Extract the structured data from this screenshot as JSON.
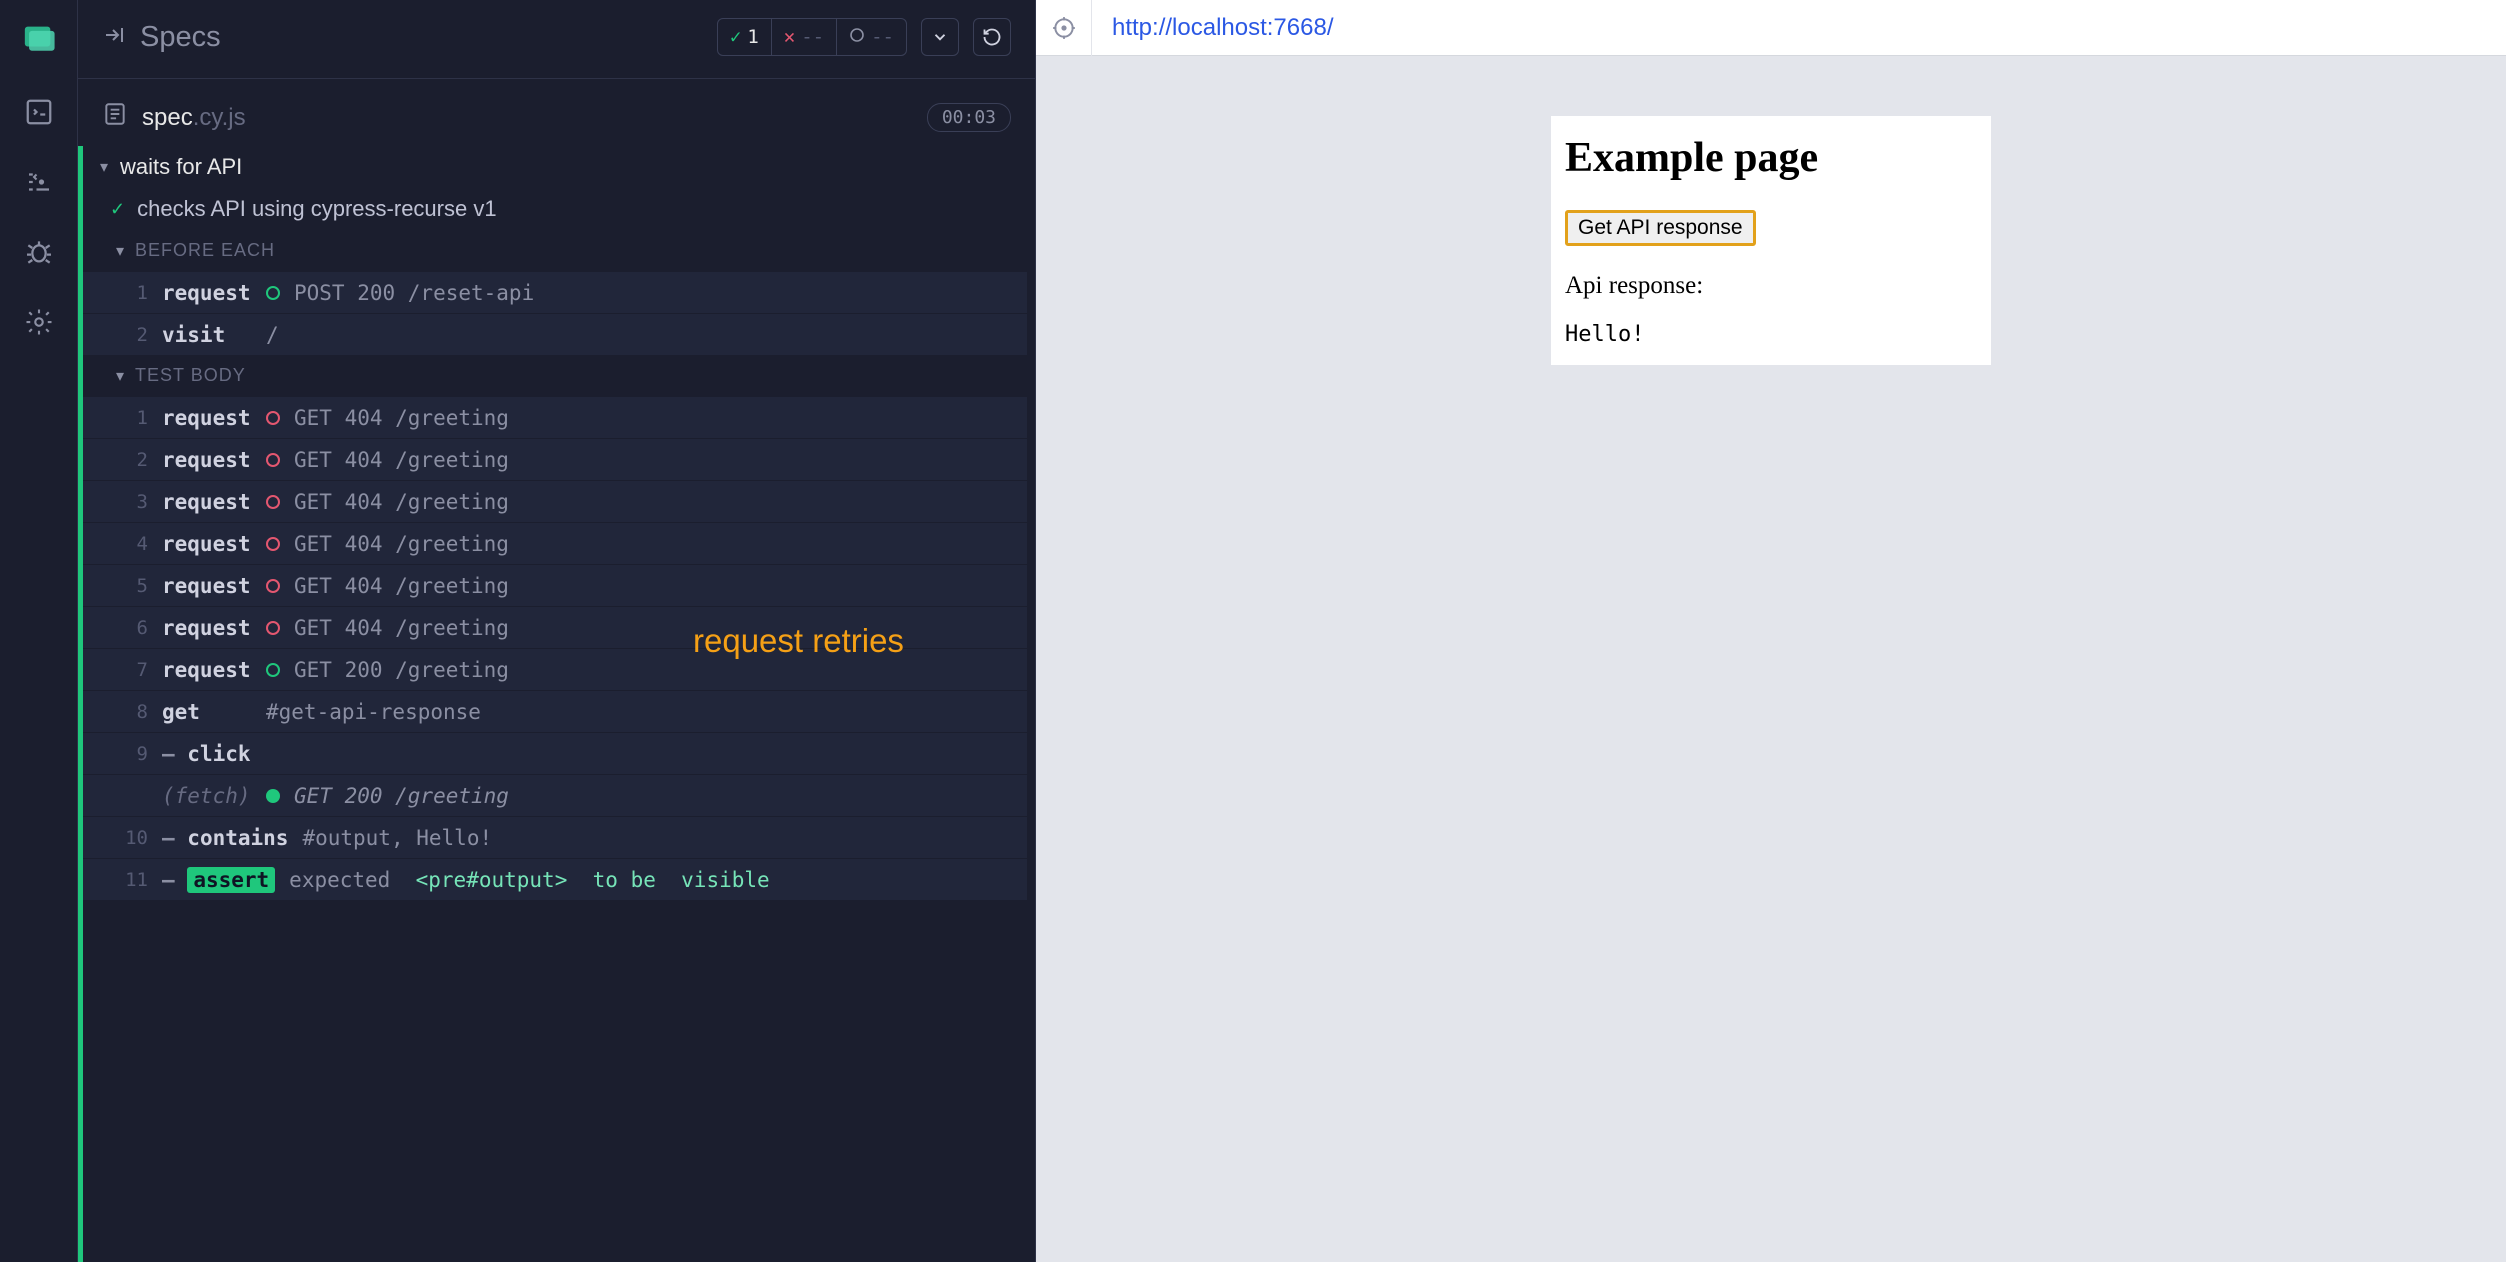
{
  "header": {
    "specs_label": "Specs",
    "pass_count": "1",
    "fail_count": "--",
    "pending_count": "--"
  },
  "spec_file": {
    "name": "spec",
    "ext": ".cy.js",
    "timer": "00:03"
  },
  "suite": {
    "title": "waits for API"
  },
  "test": {
    "title": "checks API using cypress-recurse v1"
  },
  "sections": {
    "before_each": "BEFORE EACH",
    "test_body": "TEST BODY"
  },
  "before_each": [
    {
      "n": "1",
      "cmd": "request",
      "dot": "green-o",
      "args": "POST 200 /reset-api"
    },
    {
      "n": "2",
      "cmd": "visit",
      "dot": "",
      "args": "/"
    }
  ],
  "test_body": [
    {
      "n": "1",
      "cmd": "request",
      "dot": "red-o",
      "args": "GET 404 /greeting"
    },
    {
      "n": "2",
      "cmd": "request",
      "dot": "red-o",
      "args": "GET 404 /greeting"
    },
    {
      "n": "3",
      "cmd": "request",
      "dot": "red-o",
      "args": "GET 404 /greeting"
    },
    {
      "n": "4",
      "cmd": "request",
      "dot": "red-o",
      "args": "GET 404 /greeting"
    },
    {
      "n": "5",
      "cmd": "request",
      "dot": "red-o",
      "args": "GET 404 /greeting"
    },
    {
      "n": "6",
      "cmd": "request",
      "dot": "red-o",
      "args": "GET 404 /greeting"
    },
    {
      "n": "7",
      "cmd": "request",
      "dot": "green-o",
      "args": "GET 200 /greeting"
    },
    {
      "n": "8",
      "cmd": "get",
      "dot": "",
      "args": "#get-api-response"
    },
    {
      "n": "9",
      "cmd": "click",
      "dash": true,
      "dot": "",
      "args": ""
    },
    {
      "n": "",
      "cmd": "(fetch)",
      "fetch": true,
      "dot": "green-f",
      "args": "GET 200 /greeting"
    },
    {
      "n": "10",
      "cmd": "contains",
      "dash": true,
      "dot": "",
      "args": "#output, Hello!"
    },
    {
      "n": "11",
      "cmd": "assert",
      "dash": true,
      "assert": true,
      "dot": "",
      "args_html": "expected  <pre#output>  to be  visible",
      "expected": "expected",
      "selector": "<pre#output>",
      "tobe": "to be",
      "state": "visible"
    }
  ],
  "annotation": "request retries",
  "preview": {
    "url": "http://localhost:7668/",
    "title": "Example page",
    "button": "Get API response",
    "resp_label": "Api response:",
    "output": "Hello!"
  }
}
